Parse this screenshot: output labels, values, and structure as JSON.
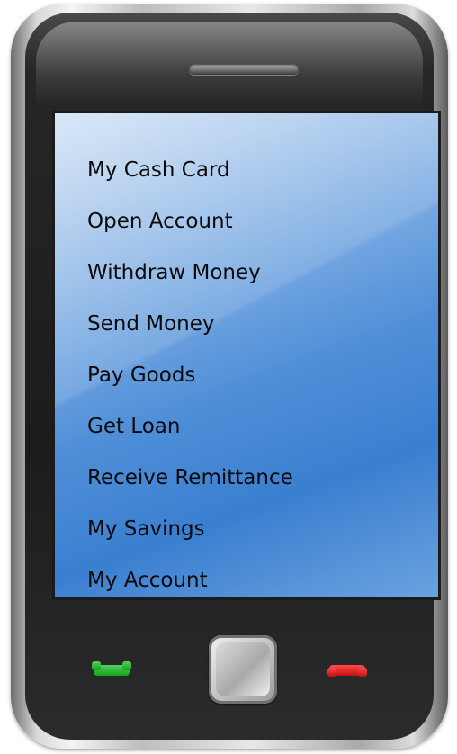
{
  "menu": {
    "items": [
      {
        "label": "My Cash Card"
      },
      {
        "label": "Open Account"
      },
      {
        "label": "Withdraw Money"
      },
      {
        "label": "Send Money"
      },
      {
        "label": "Pay Goods"
      },
      {
        "label": "Get Loan"
      },
      {
        "label": "Receive Remittance"
      },
      {
        "label": "My Savings"
      },
      {
        "label": "My Account"
      }
    ]
  },
  "controls": {
    "call_icon": "phone-call-icon",
    "end_icon": "phone-end-icon",
    "home_icon": "home-square-icon"
  },
  "colors": {
    "screen_accent": "#4f8fd8",
    "call_green": "#14a11f",
    "end_red": "#c21010"
  }
}
